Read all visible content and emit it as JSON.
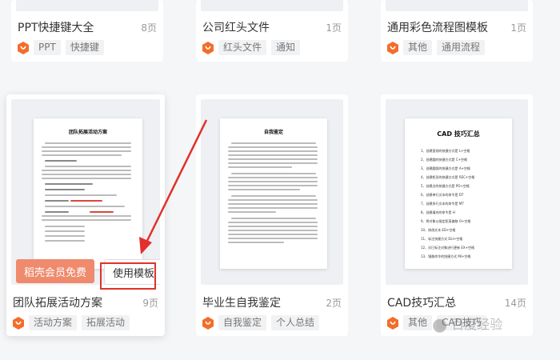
{
  "top_row": [
    {
      "title": "PPT快捷键大全",
      "pages": "8页",
      "tags": [
        "PPT",
        "快捷键"
      ]
    },
    {
      "title": "公司红头文件",
      "pages": "1页",
      "tags": [
        "红头文件",
        "通知"
      ]
    },
    {
      "title": "通用彩色流程图模板",
      "pages": "1页",
      "tags": [
        "其他",
        "通用流程"
      ]
    }
  ],
  "bottom_row": [
    {
      "title": "团队拓展活动方案",
      "pages": "9页",
      "tags": [
        "活动方案",
        "拓展活动"
      ],
      "doc_title": "团队拓展活动方案"
    },
    {
      "title": "毕业生自我鉴定",
      "pages": "2页",
      "tags": [
        "自我鉴定",
        "个人总结"
      ],
      "doc_title": "自我鉴定"
    },
    {
      "title": "CAD技巧汇总",
      "pages": "14页",
      "tags": [
        "其他",
        "CAD技巧"
      ],
      "doc_title": "CAD 技巧汇总"
    }
  ],
  "cad_items": [
    "1、创建直线的快捷方式是 L+空格",
    "2、创建圆的快捷方式是 C+空格",
    "3、创建圆弧的快捷方式是 A+空格",
    "4、创建矩形的快捷方式是 REC+空格",
    "5、创建点的快捷方式是 PO+空格",
    "6、创建单行文本的命令是 DT",
    "7、创建多行文本的命令是 MT",
    "8、创建填充的命令是 H",
    "9、将对象以指定距离偏移 O+空格",
    "10、修改文本 ED+空格",
    "11、标注快捷方式 DLI+空格",
    "12、对已标注对象进行更新 EX+空格",
    "13、镜像命令的快捷方式 MI+空格"
  ],
  "buttons": {
    "vip": "稻壳会员免费",
    "use": "使用模板"
  },
  "colors": {
    "brand": "#f36d2a",
    "vip": "#ef8a6d",
    "highlight": "#e3302a"
  },
  "watermark": "百度经验"
}
